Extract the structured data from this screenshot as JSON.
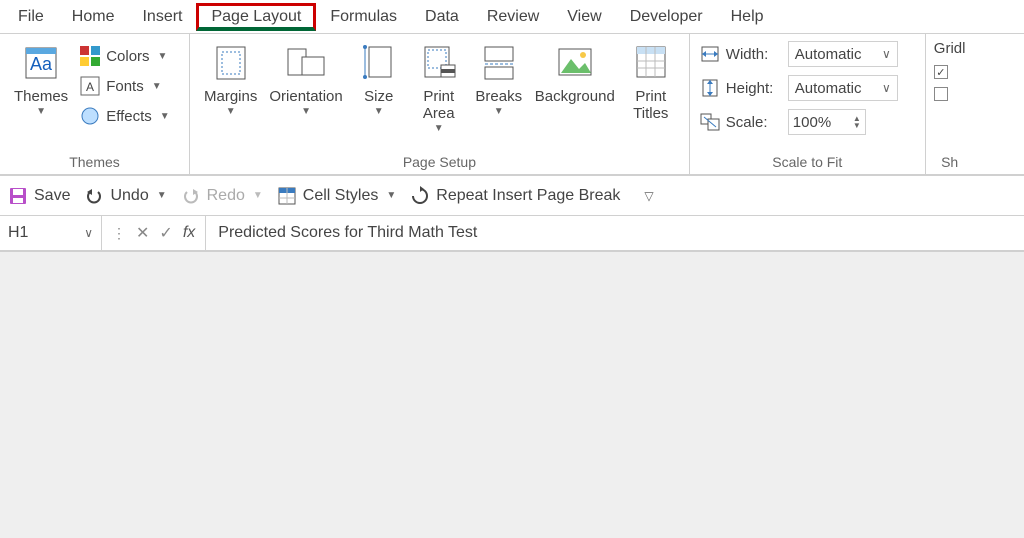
{
  "tabs": {
    "file": "File",
    "home": "Home",
    "insert": "Insert",
    "page_layout": "Page Layout",
    "formulas": "Formulas",
    "data": "Data",
    "review": "Review",
    "view": "View",
    "developer": "Developer",
    "help": "Help"
  },
  "ribbon": {
    "themes": {
      "themes": "Themes",
      "colors": "Colors",
      "fonts": "Fonts",
      "effects": "Effects",
      "group": "Themes"
    },
    "page_setup": {
      "margins": "Margins",
      "orientation": "Orientation",
      "size": "Size",
      "print_area": "Print\nArea",
      "breaks": "Breaks",
      "background": "Background",
      "print_titles": "Print\nTitles",
      "group": "Page Setup"
    },
    "scale": {
      "width": "Width:",
      "height": "Height:",
      "scale": "Scale:",
      "auto": "Automatic",
      "pct": "100%",
      "group": "Scale to Fit"
    },
    "sheet": {
      "gridlines": "Gridl",
      "group": "Sh"
    }
  },
  "qat": {
    "save": "Save",
    "undo": "Undo",
    "redo": "Redo",
    "cell_styles": "Cell Styles",
    "repeat": "Repeat Insert Page Break"
  },
  "formula_bar": {
    "cell": "H1",
    "fx": "fx",
    "content": "Predicted Scores for Third Math Test"
  }
}
